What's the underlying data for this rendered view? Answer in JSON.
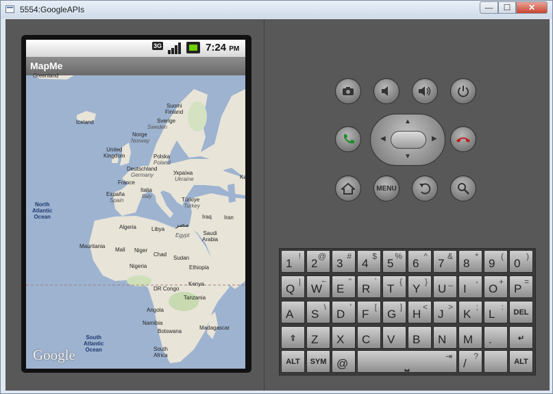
{
  "window": {
    "title": "5554:GoogleAPIs",
    "min_glyph": "—",
    "max_glyph": "☐",
    "close_glyph": "✕"
  },
  "status_bar": {
    "network_label": "3G",
    "time": "7:24",
    "ampm": "PM",
    "colors": {
      "battery": "#6fd000"
    }
  },
  "app": {
    "title": "MapMe"
  },
  "map": {
    "attribution": "Google",
    "labels": {
      "greenland": "Greenland",
      "iceland": "Iceland",
      "suomi": "Suomi",
      "finland": "Finland",
      "sverige": "Sverige",
      "sweden": "Sweden",
      "norge": "Norge",
      "norway": "Norway",
      "united_kingdom": "United\nKingdom",
      "polska": "Polska",
      "poland": "Poland",
      "deutschland": "Deutschland",
      "germany": "Germany",
      "ukraina": "Україна",
      "ukraine": "Ukraine",
      "france": "France",
      "italia": "Italia",
      "italy": "Italy",
      "espana": "España",
      "spain": "Spain",
      "turkiye": "Türkiye",
      "turkey": "Turkey",
      "ka": "Ka",
      "north_atlantic": "North\nAtlantic\nOcean",
      "iraq": "Iraq",
      "iran": "Iran",
      "algeria": "Algeria",
      "libya": "Libya",
      "misr": "مصر",
      "egypt": "Egypt",
      "saudi_arabia": "Saudi\nArabia",
      "mauritania": "Mauritania",
      "mali": "Mali",
      "niger": "Niger",
      "chad": "Chad",
      "sudan": "Sudan",
      "nigeria": "Nigeria",
      "ethiopia": "Ethiopia",
      "kenya": "Kenya",
      "dr_congo": "DR Congo",
      "tanzania": "Tanzania",
      "angola": "Angola",
      "namibia": "Namibia",
      "botswana": "Botswana",
      "madagascar": "Madagascar",
      "south_atlantic": "South\nAtlantic\nOcean",
      "south_africa": "South\nAfrica"
    }
  },
  "controls": {
    "camera": "camera-icon",
    "volume_down": "volume-down-icon",
    "volume_up": "volume-up-icon",
    "power": "power-icon",
    "call": "call-icon",
    "end_call": "end-call-icon",
    "home": "home-icon",
    "menu": "MENU",
    "back": "back-icon",
    "search": "search-icon",
    "colors": {
      "call": "#1f8f2a",
      "end_call": "#c21d1d"
    }
  },
  "keyboard": {
    "rows": [
      [
        {
          "m": "1",
          "a": "!"
        },
        {
          "m": "2",
          "a": "@"
        },
        {
          "m": "3",
          "a": "#"
        },
        {
          "m": "4",
          "a": "$"
        },
        {
          "m": "5",
          "a": "%"
        },
        {
          "m": "6",
          "a": "^"
        },
        {
          "m": "7",
          "a": "&"
        },
        {
          "m": "8",
          "a": "*"
        },
        {
          "m": "9",
          "a": "("
        },
        {
          "m": "0",
          "a": ")"
        }
      ],
      [
        {
          "m": "Q",
          "a": "|"
        },
        {
          "m": "W",
          "a": "~"
        },
        {
          "m": "E",
          "a": "\""
        },
        {
          "m": "R",
          "a": "`"
        },
        {
          "m": "T",
          "a": "{"
        },
        {
          "m": "Y",
          "a": "}"
        },
        {
          "m": "U",
          "a": "_"
        },
        {
          "m": "I",
          "a": "-"
        },
        {
          "m": "O",
          "a": "+"
        },
        {
          "m": "P",
          "a": "="
        }
      ],
      [
        {
          "m": "A",
          "a": ""
        },
        {
          "m": "S",
          "a": "\\"
        },
        {
          "m": "D",
          "a": "'"
        },
        {
          "m": "F",
          "a": "["
        },
        {
          "m": "G",
          "a": "]"
        },
        {
          "m": "H",
          "a": "<"
        },
        {
          "m": "J",
          "a": ">"
        },
        {
          "m": "K",
          "a": ";"
        },
        {
          "m": "L",
          "a": ":"
        },
        {
          "s": "DEL"
        }
      ],
      [
        {
          "s": "⇧"
        },
        {
          "m": "Z",
          "a": ""
        },
        {
          "m": "X",
          "a": ""
        },
        {
          "m": "C",
          "a": ""
        },
        {
          "m": "V",
          "a": ""
        },
        {
          "m": "B",
          "a": ""
        },
        {
          "m": "N",
          "a": ""
        },
        {
          "m": "M",
          "a": ""
        },
        {
          "m": ".",
          "a": ""
        },
        {
          "s": "↵"
        }
      ]
    ],
    "bottom": {
      "alt_left": "ALT",
      "sym": "SYM",
      "at": "@",
      "space": "⎵",
      "slash": "/",
      "question": "?",
      "tab_glyph": "⇥",
      "alt_right": "ALT"
    }
  }
}
